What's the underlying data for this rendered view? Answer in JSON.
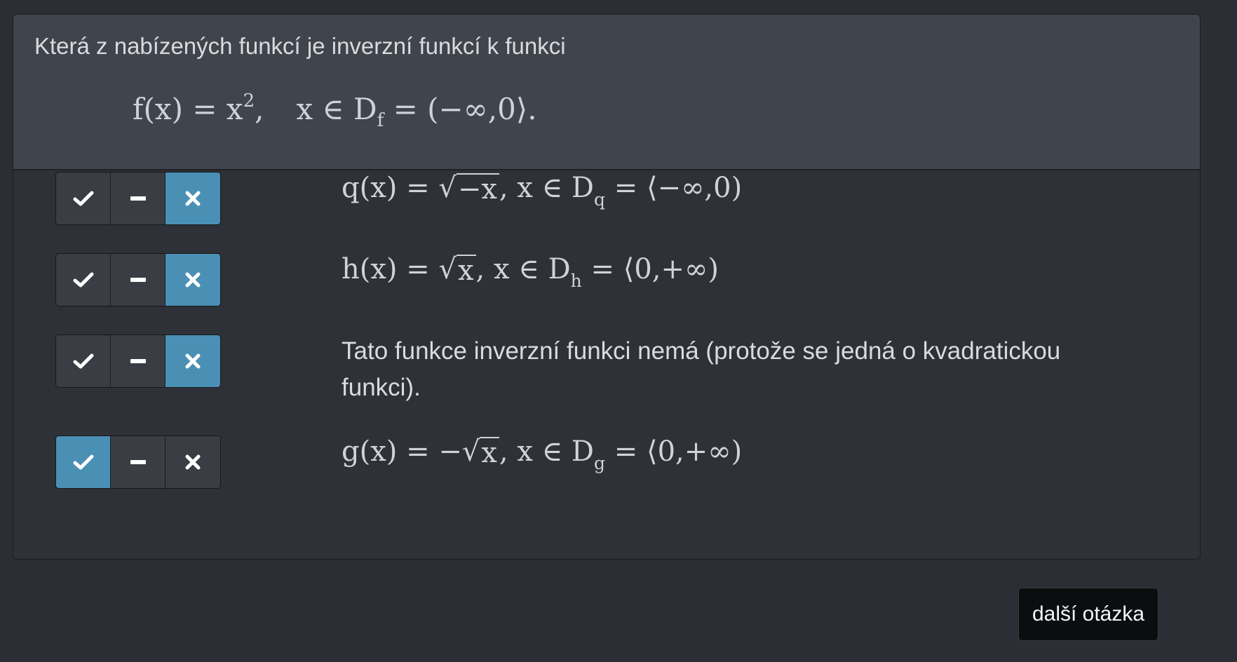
{
  "question": {
    "text": "Která z nabízených funkcí je inverzní funkcí k funkci",
    "formula": {
      "lhs": "f(x) = x",
      "power": "2",
      "comma": ",",
      "domain_prefix": "x ∈ D",
      "domain_sub": "f",
      "domain_rest": " = (−∞,0⟩."
    }
  },
  "options": [
    {
      "id": "q",
      "selected": "wrong",
      "pre": "q(x) = ",
      "radicand": "−x",
      "mid": ", x ∈ D",
      "sub": "q",
      "post": " = ⟨−∞,0)"
    },
    {
      "id": "h",
      "selected": "wrong",
      "pre": "h(x) = ",
      "radicand": "x",
      "mid": ", x ∈ D",
      "sub": "h",
      "post": " = ⟨0,+∞)"
    },
    {
      "id": "none",
      "selected": "wrong",
      "text": "Tato funkce inverzní funkci nemá (protože se jedná o kvadratickou funkci)."
    },
    {
      "id": "g",
      "selected": "correct",
      "pre": "g(x) = −",
      "radicand": "x",
      "mid": ", x ∈ D",
      "sub": "g",
      "post": " = ⟨0,+∞)"
    }
  ],
  "buttons": {
    "correct_icon": "check-icon",
    "neutral_icon": "minus-icon",
    "wrong_icon": "times-icon"
  },
  "next_button": {
    "label": "další otázka"
  },
  "colors": {
    "active": "#4a90b4",
    "header_bg": "#40444c",
    "page_bg": "#2b2e34"
  }
}
